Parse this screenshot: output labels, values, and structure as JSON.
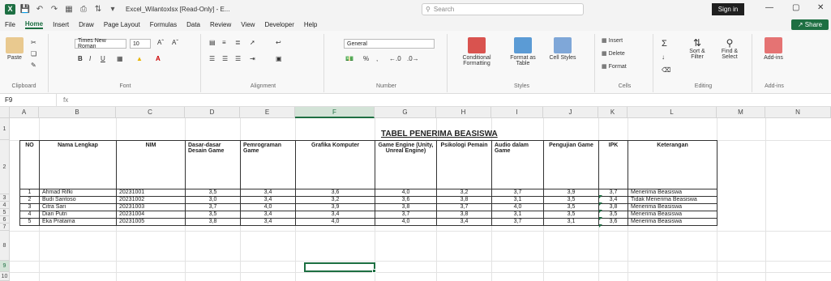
{
  "titlebar": {
    "doc_title": "Excel_Wilantoxlsx [Read-Only] - E...",
    "search_placeholder": "Search",
    "signin_label": "Sign in",
    "minimize": "—",
    "maximize": "▢",
    "close": "✕"
  },
  "menu": {
    "items": [
      "File",
      "Home",
      "Insert",
      "Draw",
      "Page Layout",
      "Formulas",
      "Data",
      "Review",
      "View",
      "Developer",
      "Help"
    ],
    "share_label": "Share"
  },
  "ribbon": {
    "clipboard": {
      "paste": "Paste",
      "label": "Clipboard"
    },
    "font": {
      "family": "Times New Roman",
      "size": "10",
      "label": "Font",
      "bold": "B",
      "italic": "I",
      "underline": "U"
    },
    "alignment": {
      "label": "Alignment"
    },
    "number": {
      "format": "General",
      "label": "Number",
      "percent": "%"
    },
    "styles": {
      "conditional": "Conditional Formatting",
      "format_table": "Format as Table",
      "cell_styles": "Cell Styles",
      "label": "Styles"
    },
    "cells": {
      "insert": "Insert",
      "delete": "Delete",
      "format": "Format",
      "label": "Cells"
    },
    "editing": {
      "sort": "Sort & Filter",
      "find": "Find & Select",
      "label": "Editing"
    },
    "addins": {
      "addins": "Add-ins",
      "label": "Add-ins"
    }
  },
  "formula": {
    "namebox": "F9",
    "fx": "fx"
  },
  "columns": [
    "A",
    "B",
    "C",
    "D",
    "E",
    "F",
    "G",
    "H",
    "I",
    "J",
    "K",
    "L",
    "M",
    "N"
  ],
  "rows": [
    "1",
    "2",
    "3",
    "4",
    "5",
    "6",
    "7",
    "8",
    "9",
    "10"
  ],
  "sheet": {
    "title": "TABEL PENERIMA BEASISWA",
    "headers": [
      "NO",
      "Nama Lengkap",
      "NIM",
      "Dasar-dasar Desain Game",
      "Pemrograman Game",
      "Grafika Komputer",
      "Game Engine (Unity, Unreal Engine)",
      "Psikologi Pemain",
      "Audio dalam Game",
      "Pengujian Game",
      "IPK",
      "Keterangan"
    ],
    "data": [
      [
        "1",
        "Ahmad Rifki",
        "20231001",
        "3,5",
        "3,4",
        "3,6",
        "4,0",
        "3,2",
        "3,7",
        "3,9",
        "3,7",
        "Menerima Beasiswa"
      ],
      [
        "2",
        "Budi Santoso",
        "20231002",
        "3,0",
        "3,4",
        "3,2",
        "3,6",
        "3,8",
        "3,1",
        "3,5",
        "3,4",
        "Tidak Menerima Beasiswa"
      ],
      [
        "3",
        "Citra Sari",
        "20231003",
        "3,7",
        "4,0",
        "3,9",
        "3,8",
        "3,7",
        "4,0",
        "3,5",
        "3,8",
        "Menerima Beasiswa"
      ],
      [
        "4",
        "Dian Putri",
        "20231004",
        "3,5",
        "3,4",
        "3,4",
        "3,7",
        "3,8",
        "3,1",
        "3,5",
        "3,5",
        "Menerima Beasiswa"
      ],
      [
        "5",
        "Eka Pratama",
        "20231005",
        "3,8",
        "3,4",
        "4,0",
        "4,0",
        "3,4",
        "3,7",
        "3,1",
        "3,6",
        "Menerima Beasiswa"
      ]
    ]
  },
  "colors": {
    "accent": "#1d6f42"
  }
}
